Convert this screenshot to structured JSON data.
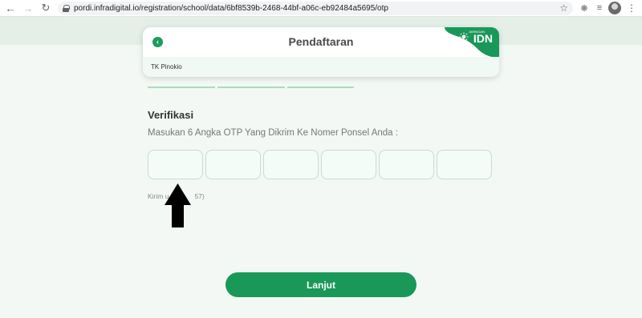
{
  "browser": {
    "url": "pordi.infradigital.io/registration/school/data/6bf8539b-2468-44bf-a06c-eb92484a5695/otp",
    "icons": [
      "back-icon",
      "forward-icon",
      "reload-icon",
      "lock-icon",
      "star-icon",
      "extensions-icon",
      "media-icon",
      "profile-avatar",
      "menu-icon"
    ]
  },
  "header": {
    "title": "Pendaftaran",
    "badge_small": "JARINGAN",
    "badge_text": "IDN",
    "school": "TK Pinokio"
  },
  "verification": {
    "title": "Verifikasi",
    "instruction": "Masukan 6 Angka OTP Yang Dikrim Ke Nomer Ponsel Anda :",
    "otp_digits": [
      "",
      "",
      "",
      "",
      "",
      ""
    ],
    "resend_prefix": "Kirim u",
    "resend_suffix": "57)"
  },
  "submit_label": "Lanjut",
  "colors": {
    "brand_green": "#1a9858",
    "page_background": "#f3f8f5",
    "otp_box_fill": "#f4fcf7"
  }
}
